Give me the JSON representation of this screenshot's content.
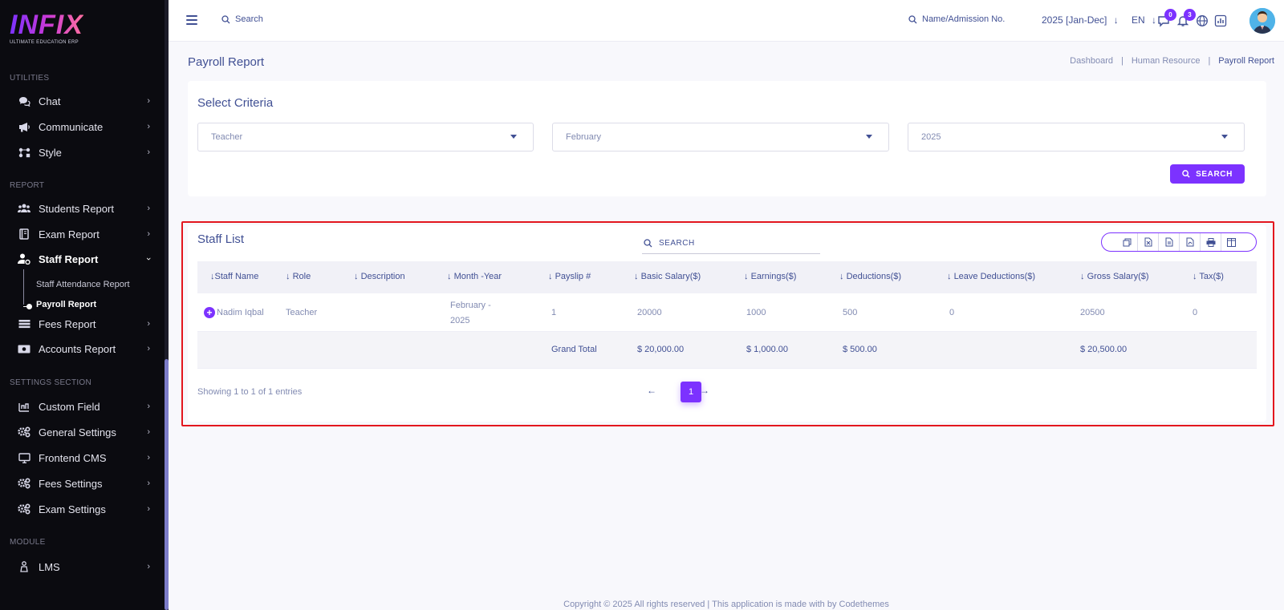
{
  "brand": {
    "logo": "INFIX",
    "tagline": "ULTIMATE EDUCATION ERP"
  },
  "sidebar": {
    "sections": {
      "utilities": "UTILITIES",
      "report": "REPORT",
      "settings": "SETTINGS SECTION",
      "module": "MODULE"
    },
    "utilities": [
      {
        "label": "Chat",
        "icon": "chat-icon"
      },
      {
        "label": "Communicate",
        "icon": "megaphone-icon"
      },
      {
        "label": "Style",
        "icon": "style-icon"
      }
    ],
    "report": [
      {
        "label": "Students Report",
        "icon": "users-icon"
      },
      {
        "label": "Exam Report",
        "icon": "book-icon"
      },
      {
        "label": "Staff Report",
        "icon": "user-gear-icon"
      },
      {
        "label": "Fees Report",
        "icon": "money-icon"
      },
      {
        "label": "Accounts Report",
        "icon": "accounts-icon"
      }
    ],
    "staff_sub": [
      {
        "label": "Staff Attendance Report"
      },
      {
        "label": "Payroll Report"
      }
    ],
    "settings": [
      {
        "label": "Custom Field",
        "icon": "field-icon"
      },
      {
        "label": "General Settings",
        "icon": "gears-icon"
      },
      {
        "label": "Frontend CMS",
        "icon": "monitor-icon"
      },
      {
        "label": "Fees Settings",
        "icon": "gears-icon"
      },
      {
        "label": "Exam Settings",
        "icon": "gears-icon"
      }
    ],
    "module": [
      {
        "label": "LMS",
        "icon": "lms-icon"
      }
    ]
  },
  "header": {
    "search_label": "Search",
    "name_search_label": "Name/Admission No.",
    "year": "2025 [Jan-Dec]",
    "language": "EN",
    "messages_count": "0",
    "notifications_count": "3"
  },
  "page": {
    "title": "Payroll Report",
    "breadcrumb": [
      "Dashboard",
      "Human Resource",
      "Payroll Report"
    ]
  },
  "criteria": {
    "title": "Select Criteria",
    "role": "Teacher",
    "month": "February",
    "year": "2025",
    "search_button": "SEARCH"
  },
  "staff_list": {
    "title": "Staff List",
    "search_placeholder": "SEARCH",
    "columns": [
      "Staff Name",
      "Role",
      "Description",
      "Month -Year",
      "Payslip #",
      "Basic Salary($)",
      "Earnings($)",
      "Deductions($)",
      "Leave Deductions($)",
      "Gross Salary($)",
      "Tax($)"
    ],
    "rows": [
      {
        "staff_name": "Nadim Iqbal",
        "role": "Teacher",
        "description": "",
        "month_line1": "February -",
        "month_line2": "2025",
        "payslip": "1",
        "basic_salary": "20000",
        "earnings": "1000",
        "deductions": "500",
        "leave_deductions": "0",
        "gross_salary": "20500",
        "tax": "0"
      }
    ],
    "totals": {
      "label": "Grand Total",
      "basic_salary": "$ 20,000.00",
      "earnings": "$ 1,000.00",
      "deductions": "$ 500.00",
      "gross_salary": "$ 20,500.00"
    },
    "showing": "Showing 1 to 1 of 1 entries",
    "current_page": "1"
  },
  "footer": "Copyright © 2025 All rights reserved | This application is made with by Codethemes",
  "colors": {
    "accent": "#7c32ff",
    "text": "#415094",
    "muted": "#828bb2",
    "sidebar_bg": "#0b0b10",
    "highlight": "#e3161e"
  }
}
